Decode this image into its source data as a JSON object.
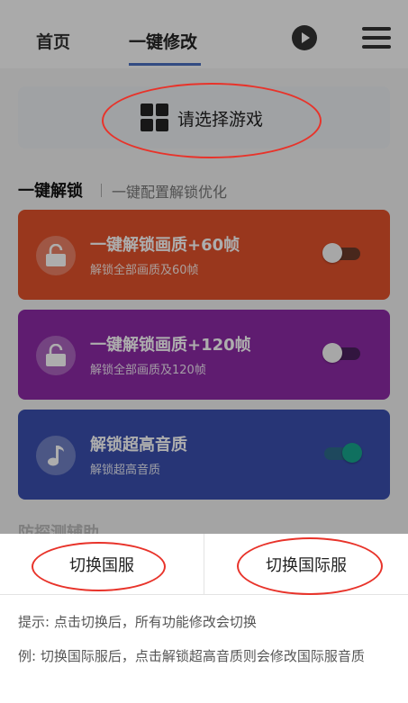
{
  "header": {
    "tabs": [
      {
        "label": "首页"
      },
      {
        "label": "一键修改"
      }
    ],
    "accent_color": "#4a6fc0",
    "play_icon": "play-circle-icon",
    "menu_icon": "hamburger-menu-icon"
  },
  "game_select": {
    "label": "请选择游戏",
    "icon": "grid-icon"
  },
  "unlock_section": {
    "title": "一键解锁",
    "subtitle": "一键配置解锁优化"
  },
  "cards": [
    {
      "title": "一键解锁画质+60帧",
      "desc": "解锁全部画质及60帧",
      "icon": "unlock-icon",
      "color": "#e2512b",
      "enabled": false
    },
    {
      "title": "一键解锁画质+120帧",
      "desc": "解锁全部画质及120帧",
      "icon": "unlock-icon",
      "color": "#8d2aa6",
      "enabled": false
    },
    {
      "title": "解锁超高音质",
      "desc": "解锁超高音质",
      "icon": "music-note-icon",
      "color": "#3a4fae",
      "enabled": true
    }
  ],
  "next_section": {
    "title": "防探测辅助"
  },
  "region_sheet": {
    "buttons": [
      {
        "label": "切换国服"
      },
      {
        "label": "切换国际服"
      }
    ],
    "tip_1": "提示: 点击切换后，所有功能修改会切换",
    "tip_2": "例: 切换国际服后，点击解锁超高音质则会修改国际服音质"
  },
  "annotation_color": "#e8332a"
}
